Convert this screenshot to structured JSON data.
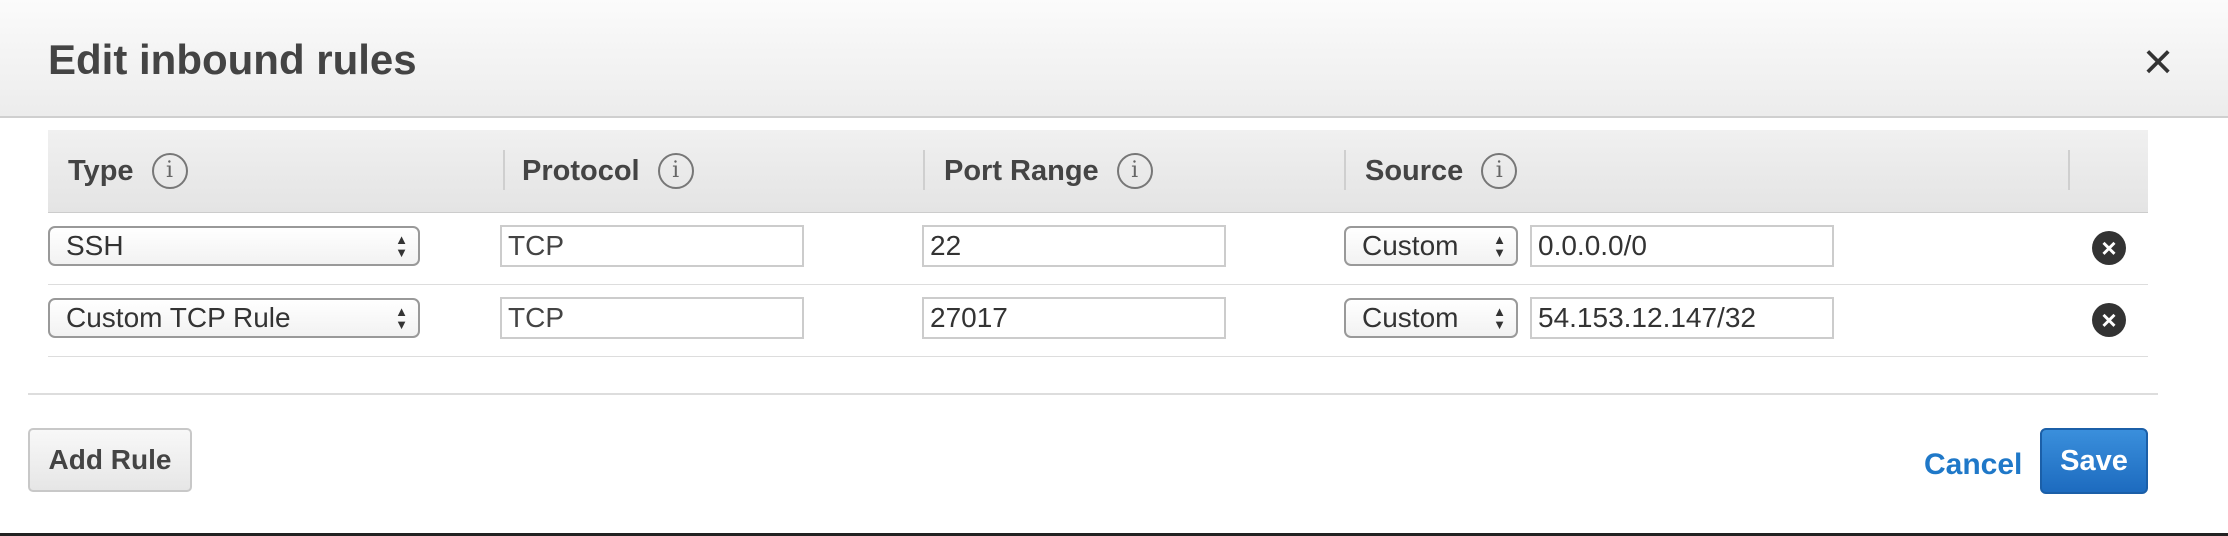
{
  "dialog": {
    "title": "Edit inbound rules",
    "close_icon": "close-icon"
  },
  "table": {
    "columns": [
      {
        "label": "Type",
        "info_icon": "i"
      },
      {
        "label": "Protocol",
        "info_icon": "i"
      },
      {
        "label": "Port Range",
        "info_icon": "i"
      },
      {
        "label": "Source",
        "info_icon": "i"
      }
    ],
    "rows": [
      {
        "type": "SSH",
        "protocol": "TCP",
        "port_range": "22",
        "source_type": "Custom",
        "source_value": "0.0.0.0/0"
      },
      {
        "type": "Custom TCP Rule",
        "protocol": "TCP",
        "port_range": "27017",
        "source_type": "Custom",
        "source_value": "54.153.12.147/32"
      }
    ]
  },
  "footer": {
    "add_rule_label": "Add Rule",
    "cancel_label": "Cancel",
    "save_label": "Save"
  },
  "colors": {
    "primary_button": "#1d6bbf",
    "link": "#1f78c8"
  }
}
